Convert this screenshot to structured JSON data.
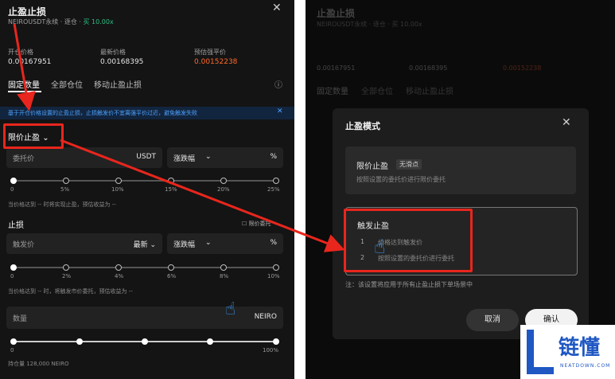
{
  "left": {
    "title": "止盈止损",
    "pair": "NEIROUSDT永续",
    "mode": "逐仓",
    "side": "买 10.00x",
    "open_price_label": "开仓价格",
    "open_price": "0.00167951",
    "latest_label": "最新价格",
    "latest": "0.00168395",
    "liq_label": "预估强平价",
    "liq": "0.00152238",
    "tabs": [
      "固定数量",
      "全部仓位",
      "移动止盈止损"
    ],
    "banner": "基于开仓价格设置的止盈止损，止损触发价不宜离强平价过近，避免触发失败",
    "tp_mode": "限价止盈",
    "entrust_placeholder": "委托价",
    "entrust_unit": "USDT",
    "change_label": "涨跌幅",
    "percent": "%",
    "tp_ticks": [
      "0",
      "5%",
      "10%",
      "15%",
      "20%",
      "25%"
    ],
    "tp_note": "当价格达到 -- 时将实现止盈，预估收益为 --",
    "sl_title": "止损",
    "sl_limit_label": "限价委托",
    "trigger_placeholder": "触发价",
    "trigger_type": "最新",
    "sl_ticks": [
      "0",
      "2%",
      "4%",
      "6%",
      "8%",
      "10%"
    ],
    "sl_note": "当价格达到 -- 时，将触发市价委托，预估收益为 --",
    "qty_placeholder": "数量",
    "qty_unit": "NEIRO",
    "qty_ticks_left": "0",
    "qty_ticks_right": "100%",
    "holding": "持仓量 128,000 NEIRO"
  },
  "right_bg": {
    "title": "止盈止损",
    "pair": "NEIROUSDT永续 · 逐仓 · 买 10.00x",
    "open_price": "0.00167951",
    "latest": "0.00168395",
    "liq": "0.00152238",
    "tab1": "固定数量",
    "tab2": "全部仓位",
    "tab3": "移动止盈止损"
  },
  "modal": {
    "title": "止盈模式",
    "opt1_title": "限价止盈",
    "opt1_badge": "无滑点",
    "opt1_desc": "按照设置的委托价进行限价委托",
    "opt2_title": "触发止盈",
    "opt2_step1_num": "1",
    "opt2_step1": "价格达到触发价",
    "opt2_step2_num": "2",
    "opt2_step2": "按照设置的委托价进行委托",
    "footnote": "注：该设置将应用于所有止盈止损下单场景中",
    "cancel": "取消",
    "confirm": "确认"
  },
  "logo": {
    "name": "链懂",
    "domain": "NEATDOWN.COM"
  },
  "colors": {
    "accent_red": "#e8261d",
    "price_orange": "#ff6a2a",
    "buy_green": "#2ebd85"
  }
}
